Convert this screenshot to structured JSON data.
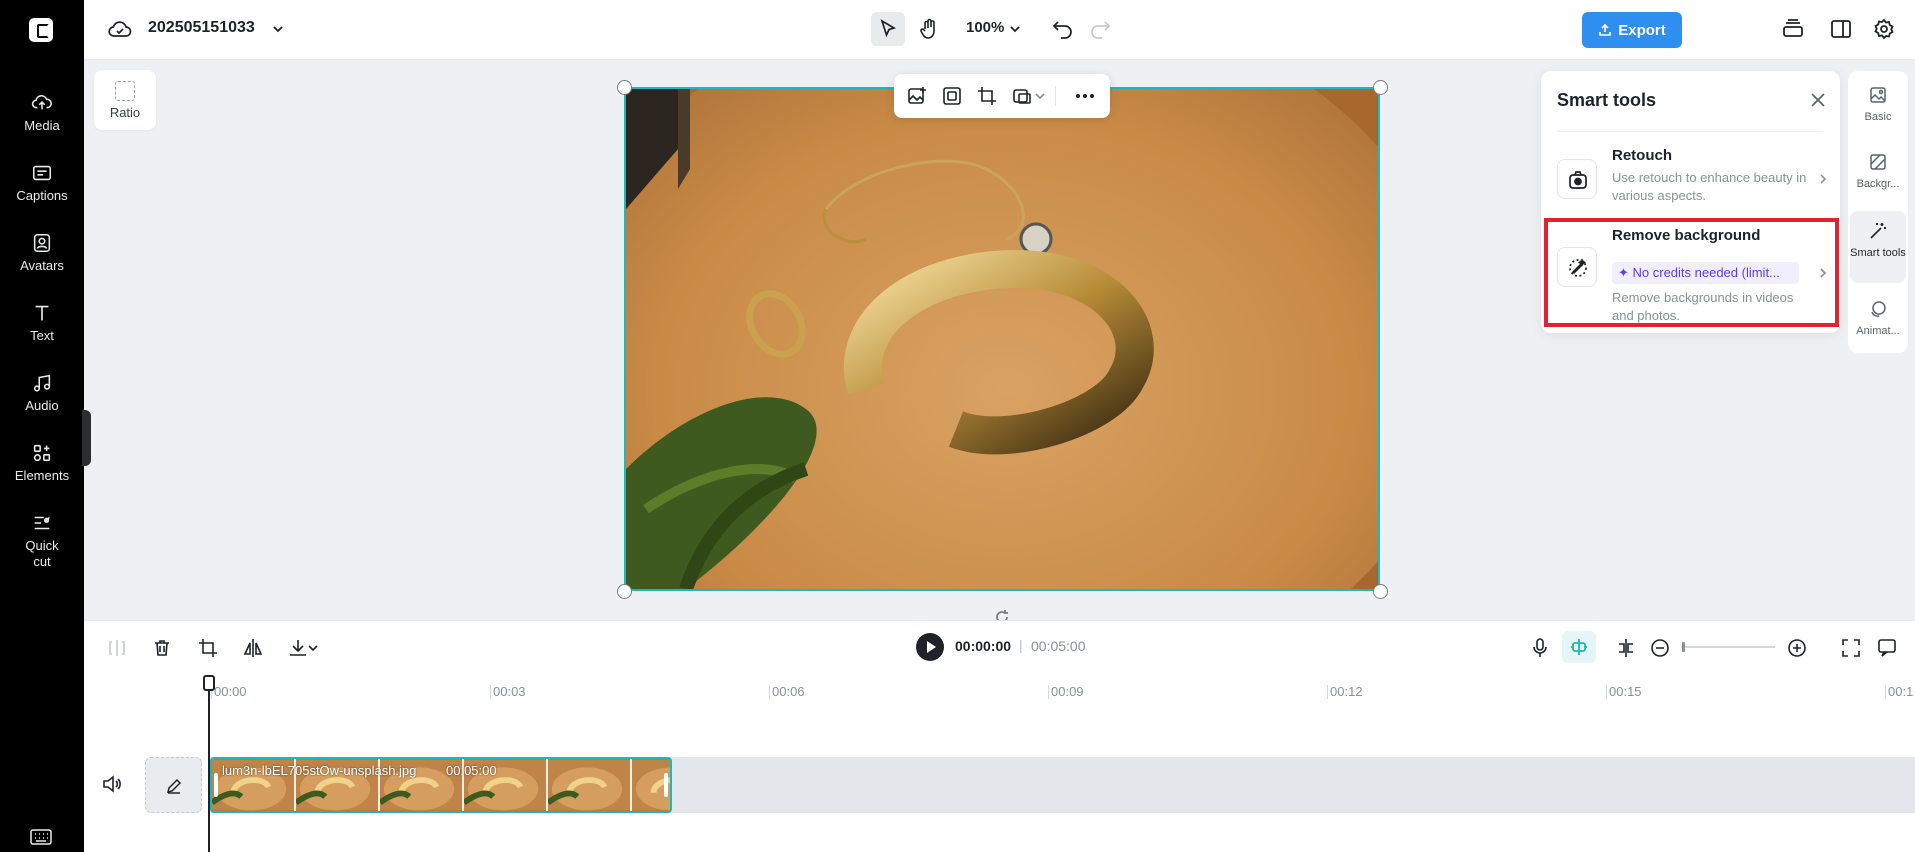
{
  "sidebar": {
    "items": [
      {
        "label": "Media",
        "icon": "cloud-upload-icon"
      },
      {
        "label": "Captions",
        "icon": "captions-icon"
      },
      {
        "label": "Avatars",
        "icon": "avatar-icon"
      },
      {
        "label": "Text",
        "icon": "text-icon"
      },
      {
        "label": "Audio",
        "icon": "music-note-icon"
      },
      {
        "label": "Elements",
        "icon": "elements-icon"
      },
      {
        "label": "Quick\ncut",
        "icon": "quick-cut-icon"
      }
    ]
  },
  "header": {
    "project_name": "202505151033",
    "zoom": "100%",
    "export_label": "Export"
  },
  "canvas": {
    "ratio_label": "Ratio"
  },
  "smart_tools": {
    "title": "Smart tools",
    "items": [
      {
        "name": "Retouch",
        "description": "Use retouch to enhance beauty in various aspects."
      },
      {
        "name": "Remove background",
        "badge": "✦ No credits needed (limit...",
        "description": "Remove backgrounds in videos and photos."
      }
    ]
  },
  "right_rail": {
    "items": [
      {
        "label": "Basic"
      },
      {
        "label": "Backgr..."
      },
      {
        "label": "Smart tools"
      },
      {
        "label": "Animat..."
      }
    ]
  },
  "timeline": {
    "current_time": "00:00:00",
    "separator": "|",
    "total_time": "00:05:00",
    "zoom_level": 0.02,
    "ruler": [
      "00:00",
      "00:03",
      "00:06",
      "00:09",
      "00:12",
      "00:15",
      "00:1"
    ],
    "clip": {
      "name": "lum3n-lbEL705stOw-unsplash.jpg",
      "duration": "00:05:00"
    }
  },
  "colors": {
    "accent": "#2f8ff0",
    "selection": "#1fb5c1",
    "highlight": "#e0232d",
    "badge_text": "#5b3cf0"
  }
}
